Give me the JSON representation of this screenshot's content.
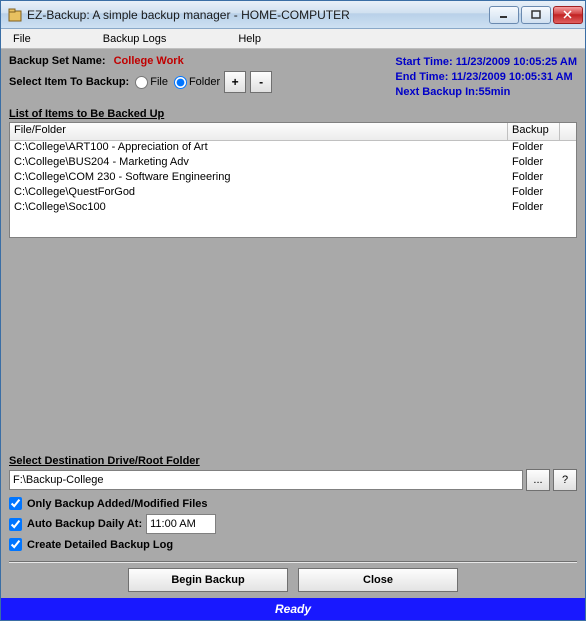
{
  "title": "EZ-Backup: A simple backup manager - HOME-COMPUTER",
  "menu": {
    "file": "File",
    "logs": "Backup Logs",
    "help": "Help"
  },
  "labels": {
    "backup_set_name": "Backup Set Name:",
    "set_name_value": "College Work",
    "select_item": "Select Item To Backup:",
    "file_radio": "File",
    "folder_radio": "Folder",
    "plus": "+",
    "minus": "-",
    "list_header": "List of Items to Be Backed Up",
    "dest_header": "Select Destination Drive/Root Folder",
    "browse": "...",
    "help": "?",
    "only_modified": "Only Backup Added/Modified Files",
    "auto_daily": "Auto Backup Daily At:",
    "detailed_log": "Create Detailed Backup Log",
    "begin": "Begin Backup",
    "close": "Close"
  },
  "times": {
    "start": "Start Time: 11/23/2009 10:05:25 AM",
    "end": "End Time: 11/23/2009 10:05:31 AM",
    "next": "Next Backup In:55min"
  },
  "columns": {
    "file_folder": "File/Folder",
    "backup": "Backup"
  },
  "items": [
    {
      "path": "C:\\College\\ART100 - Appreciation of Art",
      "type": "Folder"
    },
    {
      "path": "C:\\College\\BUS204 - Marketing Adv",
      "type": "Folder"
    },
    {
      "path": "C:\\College\\COM 230 - Software Engineering",
      "type": "Folder"
    },
    {
      "path": "C:\\College\\QuestForGod",
      "type": "Folder"
    },
    {
      "path": "C:\\College\\Soc100",
      "type": "Folder"
    }
  ],
  "dest_value": "F:\\Backup-College",
  "auto_time": "11:00 AM",
  "status": "Ready"
}
